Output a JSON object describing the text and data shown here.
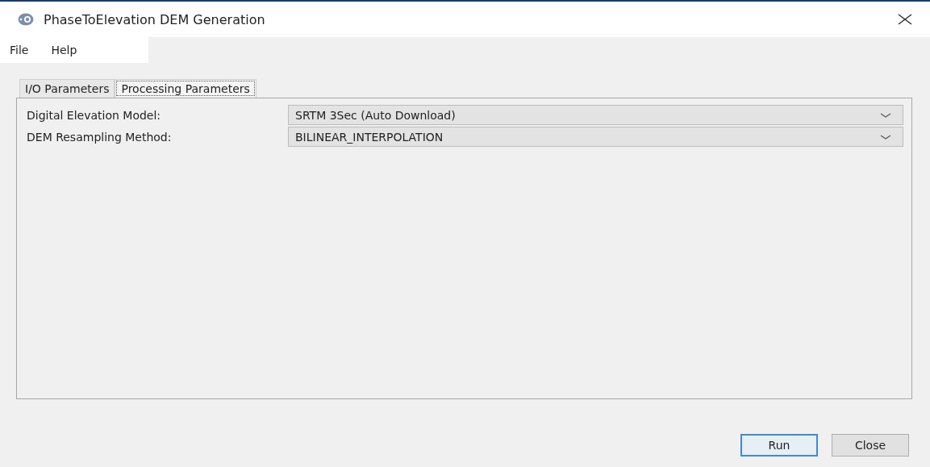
{
  "window": {
    "title": "PhaseToElevation DEM Generation"
  },
  "menu": [
    "File",
    "Help"
  ],
  "tabs": [
    {
      "label": "I/O Parameters",
      "selected": false
    },
    {
      "label": "Processing Parameters",
      "selected": true
    }
  ],
  "fields": [
    {
      "label": "Digital Elevation Model:",
      "value": "SRTM 3Sec (Auto Download)"
    },
    {
      "label": "DEM Resampling Method:",
      "value": "BILINEAR_INTERPOLATION"
    }
  ],
  "buttons": [
    {
      "label": "Run",
      "default": true
    },
    {
      "label": "Close",
      "default": false
    }
  ]
}
